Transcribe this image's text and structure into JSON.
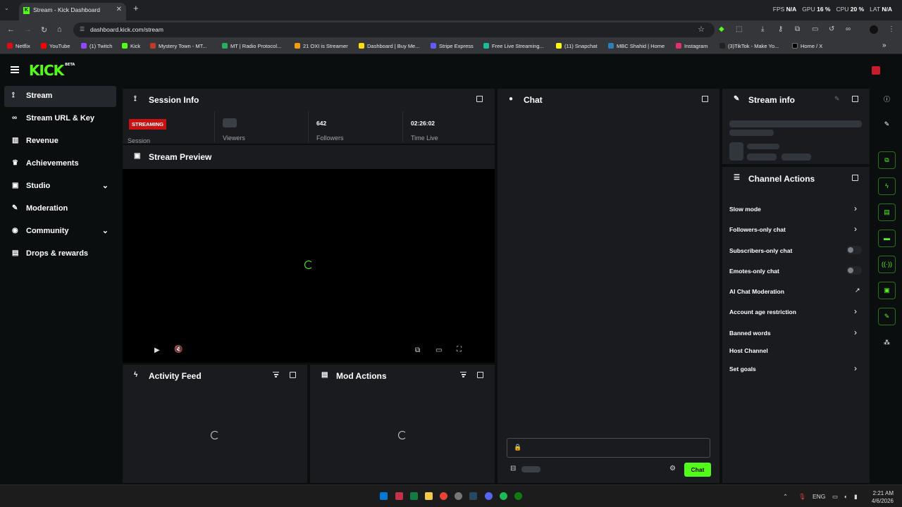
{
  "browser": {
    "tab_title": "Stream - Kick Dashboard",
    "tab_favicon": "K",
    "url": "dashboard.kick.com/stream",
    "perf": {
      "fps_label": "FPS",
      "fps_value": "N/A",
      "gpu_label": "GPU",
      "gpu_value": "16 %",
      "cpu_label": "CPU",
      "cpu_value": "20 %",
      "lat_label": "LAT",
      "lat_value": "N/A"
    },
    "bookmarks": [
      {
        "label": "Netflix",
        "color": "#e50914"
      },
      {
        "label": "YouTube",
        "color": "#ff0000"
      },
      {
        "label": "(1) Twitch",
        "color": "#9146ff"
      },
      {
        "label": "Kick",
        "color": "#53fc18"
      },
      {
        "label": "Mystery Town - MT...",
        "color": "#c0392b"
      },
      {
        "label": "MT | Radio Protocol...",
        "color": "#27ae60"
      },
      {
        "label": "21 OXI is Streamer",
        "color": "#f39c12"
      },
      {
        "label": "Dashboard | Buy Me...",
        "color": "#ffdd00"
      },
      {
        "label": "Stripe Express",
        "color": "#635bff"
      },
      {
        "label": "Free Live Streaming...",
        "color": "#1abc9c"
      },
      {
        "label": "(11) Snapchat",
        "color": "#fffc00"
      },
      {
        "label": "MBC Shahid | Home",
        "color": "#2980b9"
      },
      {
        "label": "Instagram",
        "color": "#e1306c"
      },
      {
        "label": "(3)TikTok - Make Yo...",
        "color": "#222222"
      },
      {
        "label": "Home / X",
        "color": "#000000"
      }
    ]
  },
  "brand": {
    "logo": "KICK",
    "beta": "BETA",
    "accent": "#53fc18"
  },
  "sidebar": {
    "items": [
      {
        "label": "Stream",
        "icon": "broadcast-icon"
      },
      {
        "label": "Stream URL & Key",
        "icon": "link-icon"
      },
      {
        "label": "Revenue",
        "icon": "chart-icon"
      },
      {
        "label": "Achievements",
        "icon": "trophy-icon"
      },
      {
        "label": "Studio",
        "icon": "studio-icon"
      },
      {
        "label": "Moderation",
        "icon": "wrench-icon"
      },
      {
        "label": "Community",
        "icon": "globe-icon"
      },
      {
        "label": "Drops & rewards",
        "icon": "gift-icon"
      }
    ]
  },
  "session_info": {
    "title": "Session Info",
    "status_badge": "STREAMING",
    "session_label": "Session",
    "viewers_label": "Viewers",
    "followers_value": "642",
    "followers_label": "Followers",
    "time_value": "02:26:02",
    "time_label": "Time Live"
  },
  "stream_preview": {
    "title": "Stream Preview"
  },
  "activity_feed": {
    "title": "Activity Feed"
  },
  "mod_actions": {
    "title": "Mod Actions"
  },
  "chat": {
    "title": "Chat",
    "send_label": "Chat"
  },
  "stream_info": {
    "title": "Stream info"
  },
  "channel_actions": {
    "title": "Channel Actions",
    "items": [
      {
        "label": "Slow mode",
        "control": "chevron"
      },
      {
        "label": "Followers-only chat",
        "control": "chevron"
      },
      {
        "label": "Subscribers-only chat",
        "control": "toggle"
      },
      {
        "label": "Emotes-only chat",
        "control": "toggle"
      },
      {
        "label": "AI Chat Moderation",
        "control": "external"
      },
      {
        "label": "Account age restriction",
        "control": "chevron"
      },
      {
        "label": "Banned words",
        "control": "chevron"
      },
      {
        "label": "Host Channel",
        "control": "none"
      },
      {
        "label": "Set goals",
        "control": "chevron"
      }
    ]
  },
  "taskbar": {
    "lang": "ENG",
    "time": "2:21 AM",
    "date": "4/6/2026"
  }
}
